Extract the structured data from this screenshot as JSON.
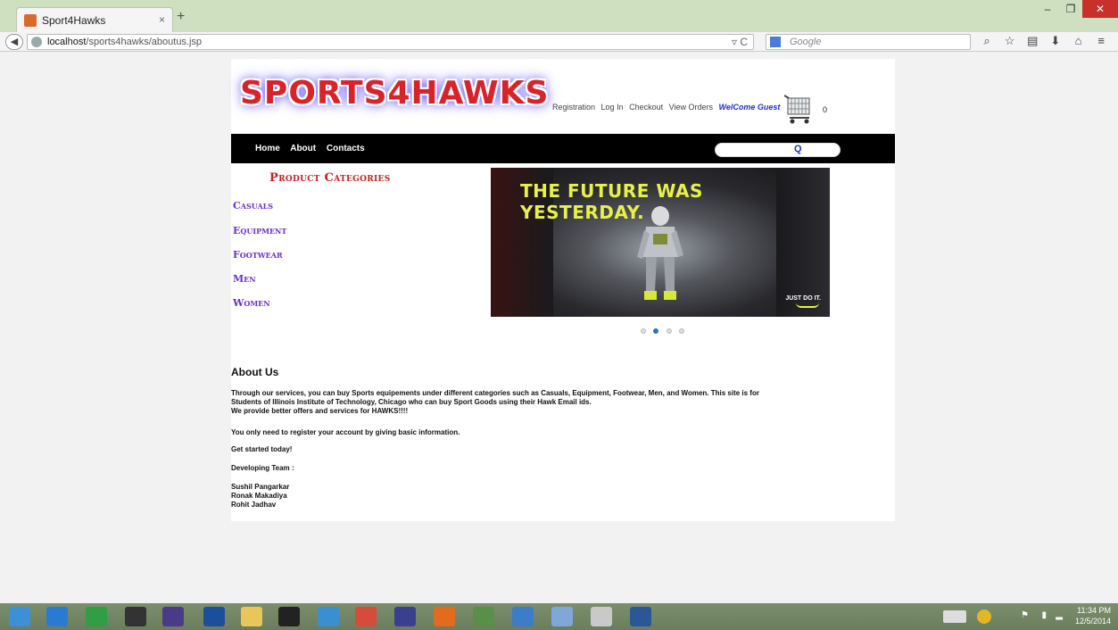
{
  "browser": {
    "tab_title": "Sport4Hawks",
    "tab_close": "×",
    "new_tab": "+",
    "url_host": "localhost",
    "url_path": "/sports4hawks/aboutus.jsp",
    "search_placeholder": "Google",
    "window_buttons": [
      "–",
      "❐",
      "✕"
    ],
    "toolbar_icons": [
      "search-icon",
      "star-icon",
      "bookmarks-icon",
      "download-icon",
      "home-icon",
      "menu-icon"
    ]
  },
  "site": {
    "logo_text": "SPORTS4HAWKS",
    "top_links": {
      "registration": "Registration",
      "login": "Log In",
      "checkout": "Checkout",
      "view_orders": "View Orders",
      "welcome": "WelCome Guest"
    },
    "cart_count": "0",
    "nav": [
      "Home",
      "About",
      "Contacts"
    ],
    "categories_title": "Product Categories",
    "categories": [
      "Casuals",
      "Equipment",
      "Footwear",
      "Men",
      "Women"
    ],
    "banner": {
      "headline": "THE FUTURE WAS YESTERDAY.",
      "tagline": "JUST DO IT."
    },
    "carousel_active_index": 1,
    "about": {
      "title": "About Us",
      "para1": "Through our services, you can buy Sports equipements under different categories such as Casuals, Equipment, Footwear, Men, and Women. This site is for",
      "para1b": "Students of Illinois Institute of Technology, Chicago who can buy Sport Goods using their Hawk Email ids.",
      "para1c": "We provide better offers and services for HAWKS!!!!",
      "para2": "You only need to register your account by giving basic information.",
      "para3": "Get started today!",
      "team_label": "Developing Team :",
      "team": [
        "Sushil Pangarkar",
        "Ronak Makadiya",
        "Rohit Jadhav"
      ]
    }
  },
  "taskbar": {
    "time": "11:34 PM",
    "date": "12/5/2014"
  }
}
